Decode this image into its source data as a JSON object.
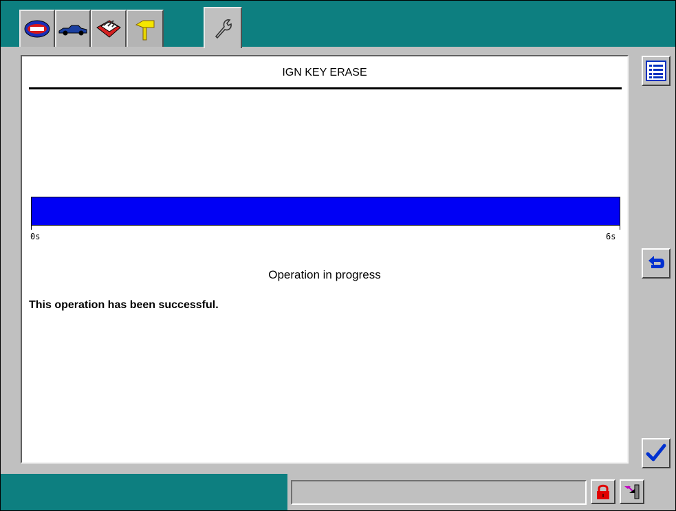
{
  "tabs": [
    {
      "icon": "badge-logo-icon"
    },
    {
      "icon": "vehicle-icon"
    },
    {
      "icon": "toolbox-icon"
    },
    {
      "icon": "signpost-icon"
    },
    {
      "icon": "wrench-icon",
      "active": true
    }
  ],
  "panel": {
    "title": "IGN KEY ERASE",
    "progress": {
      "fraction": 1.0,
      "start_label": "0s",
      "end_label": "6s",
      "bar_color": "#0000f5"
    },
    "status_text": "Operation in progress",
    "result_text": "This operation has been successful."
  },
  "sidebar": {
    "list_button_icon": "list-icon",
    "back_button_icon": "return-arrow-icon",
    "confirm_button_icon": "checkmark-icon"
  },
  "statusbar": {
    "field_text": "",
    "lock_icon": "padlock-icon",
    "connector_icon": "connector-icon"
  },
  "colors": {
    "frame_teal": "#0d7f80",
    "panel_gray": "#c0c0c0",
    "accent_blue": "#0000f5"
  }
}
